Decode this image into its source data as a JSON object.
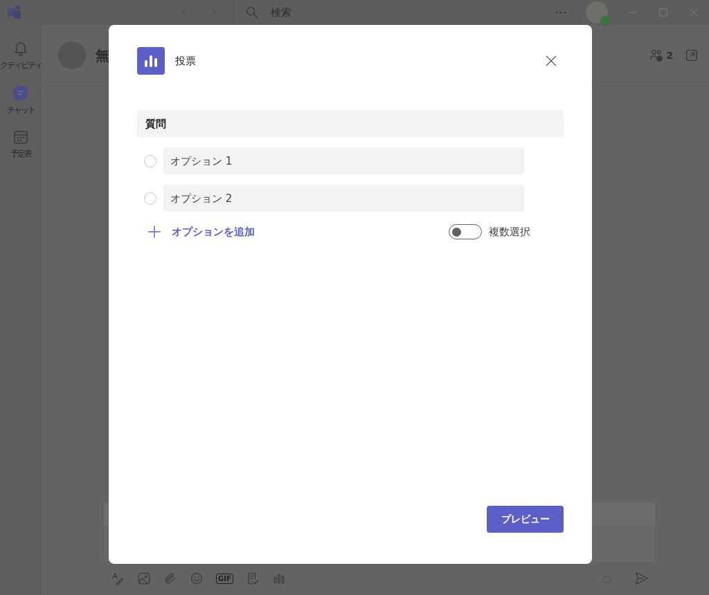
{
  "title_bar": {
    "search": {
      "placeholder": "検索"
    }
  },
  "rail": {
    "items": [
      {
        "kind": "bell",
        "label": "クティビティ",
        "selected": false
      },
      {
        "kind": "chat",
        "label": "チャット",
        "selected": true
      },
      {
        "kind": "calendar",
        "label": "予定表",
        "selected": false
      }
    ]
  },
  "chat_header": {
    "title": "無",
    "participants_count": "2"
  },
  "compose_toolbar": {
    "gif": "GIF"
  },
  "dialog": {
    "title": "投票",
    "question": {
      "placeholder": "質問"
    },
    "options": [
      {
        "placeholder": "オプション 1",
        "selected": false
      },
      {
        "placeholder": "オプション 2",
        "selected": false
      }
    ],
    "add_option": "オプションを追加",
    "multiple_choice": {
      "label": "複数選択",
      "on": false
    },
    "preview_button": "プレビュー"
  }
}
